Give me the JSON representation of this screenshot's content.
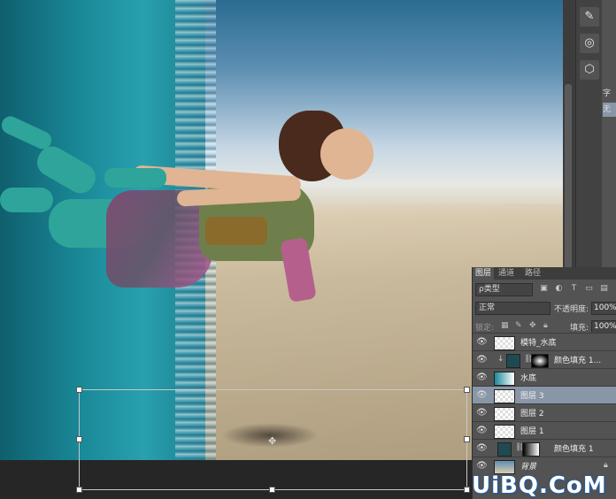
{
  "layers_panel": {
    "tabs": [
      "图层",
      "通道",
      "路径"
    ],
    "filter_label": "ρ类型",
    "blend_mode": "正常",
    "opacity_label": "不透明度:",
    "opacity_value": "100%",
    "lock_label": "锁定:",
    "fill_label": "填充:",
    "fill_value": "100%",
    "layers": [
      {
        "name": "模特_水底",
        "selected": false
      },
      {
        "name": "颜色填充 1...",
        "selected": false
      },
      {
        "name": "水底",
        "selected": false
      },
      {
        "name": "图层 3",
        "selected": true
      },
      {
        "name": "图层 2",
        "selected": false
      },
      {
        "name": "图层 1",
        "selected": false
      },
      {
        "name": "颜色填充 1",
        "selected": false
      },
      {
        "name": "背景",
        "selected": false
      }
    ]
  },
  "right_panel": {
    "cells": [
      "字",
      "无"
    ]
  },
  "watermark": "UiBQ.CoM"
}
